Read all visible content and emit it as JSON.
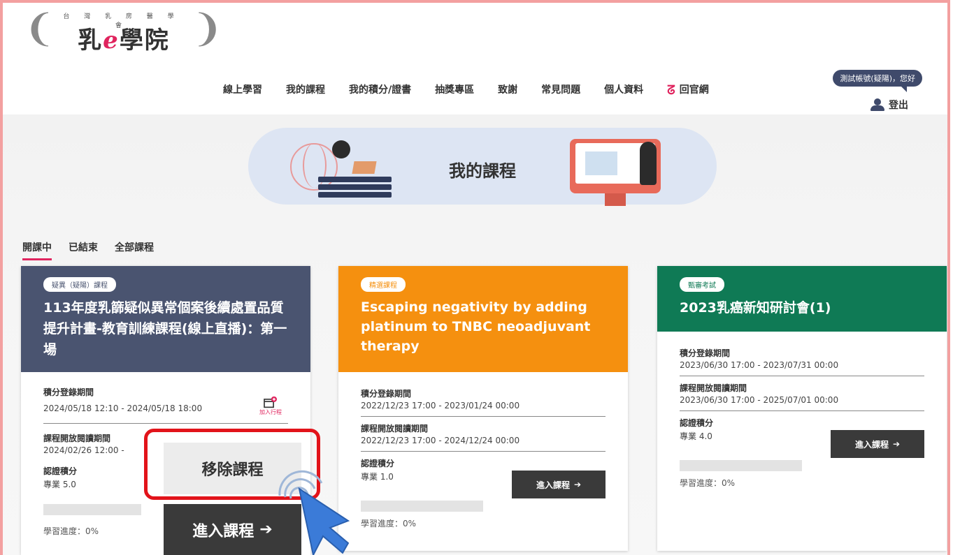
{
  "header": {
    "org_name": "台 灣 乳 房 醫 學 會",
    "brand": {
      "pre": "乳",
      "e": "e",
      "post": "學院"
    },
    "nav": [
      "線上學習",
      "我的課程",
      "我的積分/證書",
      "抽獎專區",
      "致謝",
      "常見問題",
      "個人資料"
    ],
    "official_site": "回官網",
    "user_greeting": "測試帳號(疑陽)，您好",
    "logout": "登出"
  },
  "banner": {
    "title": "我的課程"
  },
  "tabs": [
    "開課中",
    "已結束",
    "全部課程"
  ],
  "courses": [
    {
      "tag": "疑異（疑陽）課程",
      "title": "113年度乳篩疑似異常個案後續處置品質提升計畫-教育訓練課程(線上直播)：第一場",
      "credit_period_label": "積分登錄期間",
      "credit_period": "2024/05/18 12:10 - 2024/05/18 18:00",
      "add_schedule": "加入行程",
      "open_period_label": "課程開放閱讀期間",
      "open_period": "2024/02/26 12:00 -",
      "credit_label": "認證積分",
      "credit": "專業 5.0",
      "progress_label": "學習進度：0%"
    },
    {
      "tag": "精選課程",
      "title": "Escaping negativity by adding platinum to TNBC neoadjuvant therapy",
      "credit_period_label": "積分登錄期間",
      "credit_period": "2022/12/23 17:00 - 2023/01/24 00:00",
      "open_period_label": "課程開放閱讀期間",
      "open_period": "2022/12/23 17:00 - 2024/12/24 00:00",
      "credit_label": "認證積分",
      "credit": "專業 1.0",
      "enter": "進入課程",
      "progress_label": "學習進度：0%"
    },
    {
      "tag": "甄審考試",
      "title": "2023乳癌新知研討會(1)",
      "credit_period_label": "積分登錄期間",
      "credit_period": "2023/06/30 17:00 - 2023/07/31 00:00",
      "open_period_label": "課程開放閱讀期間",
      "open_period": "2023/06/30 17:00 - 2025/07/01 00:00",
      "credit_label": "認證積分",
      "credit": "專業 4.0",
      "enter": "進入課程",
      "progress_label": "學習進度：0%"
    }
  ],
  "popup": {
    "remove": "移除課程",
    "enter": "進入課程"
  },
  "colors": {
    "frame": "#f3a0a0",
    "accent": "#e0245e",
    "card1": "#4a5470",
    "card2": "#f5900f",
    "card3": "#0f7a55",
    "highlight": "#e2131a"
  }
}
